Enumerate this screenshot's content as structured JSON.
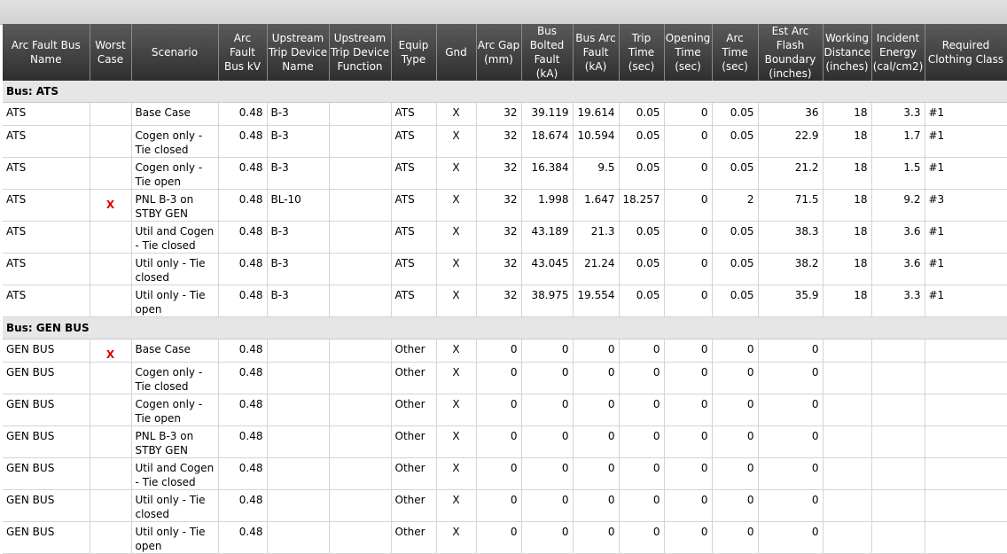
{
  "columns": [
    "Arc Fault Bus Name",
    "Worst Case",
    "Scenario",
    "Arc Fault Bus kV",
    "Upstream Trip Device Name",
    "Upstream Trip Device Function",
    "Equip Type",
    "Gnd",
    "Arc Gap (mm)",
    "Bus Bolted Fault (kA)",
    "Bus Arc Fault (kA)",
    "Trip Time (sec)",
    "Opening Time (sec)",
    "Arc Time (sec)",
    "Est Arc Flash Boundary (inches)",
    "Working Distance (inches)",
    "Incident Energy (cal/cm2)",
    "Required Clothing Class"
  ],
  "colors": {
    "header_bg": "#3a3a3a",
    "worst_mark": "#e00000",
    "group_bg": "#e6e6e6"
  },
  "groups": [
    {
      "label": "Bus: ATS",
      "rows": [
        {
          "bus": "ATS",
          "worst": "",
          "scenario": "Base Case",
          "kv": "0.48",
          "dev": "B-3",
          "func": "",
          "equip": "ATS",
          "gnd": "X",
          "gap": "32",
          "bolted": "39.119",
          "arc": "19.614",
          "trip": "0.05",
          "open": "0",
          "arct": "0.05",
          "boundary": "36",
          "wd": "18",
          "ie": "3.3",
          "cls": "#1"
        },
        {
          "bus": "ATS",
          "worst": "",
          "scenario": "Cogen only - Tie closed",
          "kv": "0.48",
          "dev": "B-3",
          "func": "",
          "equip": "ATS",
          "gnd": "X",
          "gap": "32",
          "bolted": "18.674",
          "arc": "10.594",
          "trip": "0.05",
          "open": "0",
          "arct": "0.05",
          "boundary": "22.9",
          "wd": "18",
          "ie": "1.7",
          "cls": "#1"
        },
        {
          "bus": "ATS",
          "worst": "",
          "scenario": "Cogen only - Tie open",
          "kv": "0.48",
          "dev": "B-3",
          "func": "",
          "equip": "ATS",
          "gnd": "X",
          "gap": "32",
          "bolted": "16.384",
          "arc": "9.5",
          "trip": "0.05",
          "open": "0",
          "arct": "0.05",
          "boundary": "21.2",
          "wd": "18",
          "ie": "1.5",
          "cls": "#1"
        },
        {
          "bus": "ATS",
          "worst": "X",
          "scenario": "PNL B-3 on STBY GEN",
          "kv": "0.48",
          "dev": "BL-10",
          "func": "",
          "equip": "ATS",
          "gnd": "X",
          "gap": "32",
          "bolted": "1.998",
          "arc": "1.647",
          "trip": "18.257",
          "open": "0",
          "arct": "2",
          "boundary": "71.5",
          "wd": "18",
          "ie": "9.2",
          "cls": "#3"
        },
        {
          "bus": "ATS",
          "worst": "",
          "scenario": "Util and Cogen - Tie closed",
          "kv": "0.48",
          "dev": "B-3",
          "func": "",
          "equip": "ATS",
          "gnd": "X",
          "gap": "32",
          "bolted": "43.189",
          "arc": "21.3",
          "trip": "0.05",
          "open": "0",
          "arct": "0.05",
          "boundary": "38.3",
          "wd": "18",
          "ie": "3.6",
          "cls": "#1"
        },
        {
          "bus": "ATS",
          "worst": "",
          "scenario": "Util only - Tie closed",
          "kv": "0.48",
          "dev": "B-3",
          "func": "",
          "equip": "ATS",
          "gnd": "X",
          "gap": "32",
          "bolted": "43.045",
          "arc": "21.24",
          "trip": "0.05",
          "open": "0",
          "arct": "0.05",
          "boundary": "38.2",
          "wd": "18",
          "ie": "3.6",
          "cls": "#1"
        },
        {
          "bus": "ATS",
          "worst": "",
          "scenario": "Util only - Tie open",
          "kv": "0.48",
          "dev": "B-3",
          "func": "",
          "equip": "ATS",
          "gnd": "X",
          "gap": "32",
          "bolted": "38.975",
          "arc": "19.554",
          "trip": "0.05",
          "open": "0",
          "arct": "0.05",
          "boundary": "35.9",
          "wd": "18",
          "ie": "3.3",
          "cls": "#1"
        }
      ]
    },
    {
      "label": "Bus: GEN BUS",
      "rows": [
        {
          "bus": "GEN BUS",
          "worst": "X",
          "scenario": "Base Case",
          "kv": "0.48",
          "dev": "",
          "func": "",
          "equip": "Other",
          "gnd": "X",
          "gap": "0",
          "bolted": "0",
          "arc": "0",
          "trip": "0",
          "open": "0",
          "arct": "0",
          "boundary": "0",
          "wd": "",
          "ie": "",
          "cls": ""
        },
        {
          "bus": "GEN BUS",
          "worst": "",
          "scenario": "Cogen only - Tie closed",
          "kv": "0.48",
          "dev": "",
          "func": "",
          "equip": "Other",
          "gnd": "X",
          "gap": "0",
          "bolted": "0",
          "arc": "0",
          "trip": "0",
          "open": "0",
          "arct": "0",
          "boundary": "0",
          "wd": "",
          "ie": "",
          "cls": ""
        },
        {
          "bus": "GEN BUS",
          "worst": "",
          "scenario": "Cogen only - Tie open",
          "kv": "0.48",
          "dev": "",
          "func": "",
          "equip": "Other",
          "gnd": "X",
          "gap": "0",
          "bolted": "0",
          "arc": "0",
          "trip": "0",
          "open": "0",
          "arct": "0",
          "boundary": "0",
          "wd": "",
          "ie": "",
          "cls": ""
        },
        {
          "bus": "GEN BUS",
          "worst": "",
          "scenario": "PNL B-3 on STBY GEN",
          "kv": "0.48",
          "dev": "",
          "func": "",
          "equip": "Other",
          "gnd": "X",
          "gap": "0",
          "bolted": "0",
          "arc": "0",
          "trip": "0",
          "open": "0",
          "arct": "0",
          "boundary": "0",
          "wd": "",
          "ie": "",
          "cls": ""
        },
        {
          "bus": "GEN BUS",
          "worst": "",
          "scenario": "Util and Cogen - Tie closed",
          "kv": "0.48",
          "dev": "",
          "func": "",
          "equip": "Other",
          "gnd": "X",
          "gap": "0",
          "bolted": "0",
          "arc": "0",
          "trip": "0",
          "open": "0",
          "arct": "0",
          "boundary": "0",
          "wd": "",
          "ie": "",
          "cls": ""
        },
        {
          "bus": "GEN BUS",
          "worst": "",
          "scenario": "Util only - Tie closed",
          "kv": "0.48",
          "dev": "",
          "func": "",
          "equip": "Other",
          "gnd": "X",
          "gap": "0",
          "bolted": "0",
          "arc": "0",
          "trip": "0",
          "open": "0",
          "arct": "0",
          "boundary": "0",
          "wd": "",
          "ie": "",
          "cls": ""
        },
        {
          "bus": "GEN BUS",
          "worst": "",
          "scenario": "Util only - Tie open",
          "kv": "0.48",
          "dev": "",
          "func": "",
          "equip": "Other",
          "gnd": "X",
          "gap": "0",
          "bolted": "0",
          "arc": "0",
          "trip": "0",
          "open": "0",
          "arct": "0",
          "boundary": "0",
          "wd": "",
          "ie": "",
          "cls": ""
        }
      ]
    }
  ]
}
